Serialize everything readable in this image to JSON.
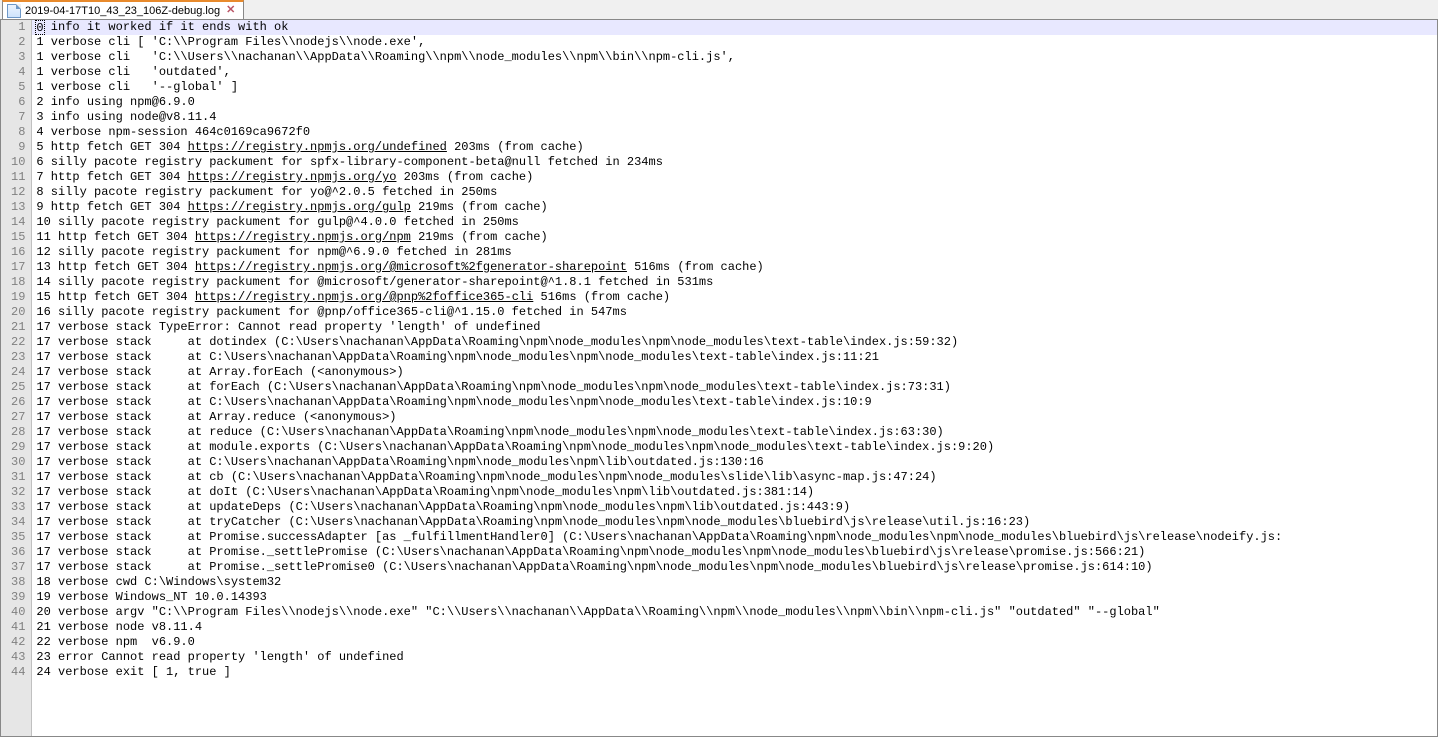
{
  "tab": {
    "title": "2019-04-17T10_43_23_106Z-debug.log",
    "close_glyph": "✕"
  },
  "urls": [
    "https://registry.npmjs.org/undefined",
    "https://registry.npmjs.org/yo",
    "https://registry.npmjs.org/gulp",
    "https://registry.npmjs.org/npm",
    "https://registry.npmjs.org/@microsoft%2fgenerator-sharepoint",
    "https://registry.npmjs.org/@pnp%2foffice365-cli"
  ],
  "lines": [
    {
      "n": 1,
      "type": "first",
      "first_char": "0",
      "rest": " info it worked if it ends with ok"
    },
    {
      "n": 2,
      "text": "1 verbose cli [ 'C:\\\\Program Files\\\\nodejs\\\\node.exe',"
    },
    {
      "n": 3,
      "text": "1 verbose cli   'C:\\\\Users\\\\nachanan\\\\AppData\\\\Roaming\\\\npm\\\\node_modules\\\\npm\\\\bin\\\\npm-cli.js',"
    },
    {
      "n": 4,
      "text": "1 verbose cli   'outdated',"
    },
    {
      "n": 5,
      "text": "1 verbose cli   '--global' ]"
    },
    {
      "n": 6,
      "text": "2 info using npm@6.9.0"
    },
    {
      "n": 7,
      "text": "3 info using node@v8.11.4"
    },
    {
      "n": 8,
      "text": "4 verbose npm-session 464c0169ca9672f0"
    },
    {
      "n": 9,
      "type": "url",
      "pre": "5 http fetch GET 304 ",
      "url_idx": 0,
      "post": " 203ms (from cache)"
    },
    {
      "n": 10,
      "text": "6 silly pacote registry packument for spfx-library-component-beta@null fetched in 234ms"
    },
    {
      "n": 11,
      "type": "url",
      "pre": "7 http fetch GET 304 ",
      "url_idx": 1,
      "post": " 203ms (from cache)"
    },
    {
      "n": 12,
      "text": "8 silly pacote registry packument for yo@^2.0.5 fetched in 250ms"
    },
    {
      "n": 13,
      "type": "url",
      "pre": "9 http fetch GET 304 ",
      "url_idx": 2,
      "post": " 219ms (from cache)"
    },
    {
      "n": 14,
      "text": "10 silly pacote registry packument for gulp@^4.0.0 fetched in 250ms"
    },
    {
      "n": 15,
      "type": "url",
      "pre": "11 http fetch GET 304 ",
      "url_idx": 3,
      "post": " 219ms (from cache)"
    },
    {
      "n": 16,
      "text": "12 silly pacote registry packument for npm@^6.9.0 fetched in 281ms"
    },
    {
      "n": 17,
      "type": "url",
      "pre": "13 http fetch GET 304 ",
      "url_idx": 4,
      "post": " 516ms (from cache)"
    },
    {
      "n": 18,
      "text": "14 silly pacote registry packument for @microsoft/generator-sharepoint@^1.8.1 fetched in 531ms"
    },
    {
      "n": 19,
      "type": "url",
      "pre": "15 http fetch GET 304 ",
      "url_idx": 5,
      "post": " 516ms (from cache)"
    },
    {
      "n": 20,
      "text": "16 silly pacote registry packument for @pnp/office365-cli@^1.15.0 fetched in 547ms"
    },
    {
      "n": 21,
      "text": "17 verbose stack TypeError: Cannot read property 'length' of undefined"
    },
    {
      "n": 22,
      "text": "17 verbose stack     at dotindex (C:\\Users\\nachanan\\AppData\\Roaming\\npm\\node_modules\\npm\\node_modules\\text-table\\index.js:59:32)"
    },
    {
      "n": 23,
      "text": "17 verbose stack     at C:\\Users\\nachanan\\AppData\\Roaming\\npm\\node_modules\\npm\\node_modules\\text-table\\index.js:11:21"
    },
    {
      "n": 24,
      "text": "17 verbose stack     at Array.forEach (<anonymous>)"
    },
    {
      "n": 25,
      "text": "17 verbose stack     at forEach (C:\\Users\\nachanan\\AppData\\Roaming\\npm\\node_modules\\npm\\node_modules\\text-table\\index.js:73:31)"
    },
    {
      "n": 26,
      "text": "17 verbose stack     at C:\\Users\\nachanan\\AppData\\Roaming\\npm\\node_modules\\npm\\node_modules\\text-table\\index.js:10:9"
    },
    {
      "n": 27,
      "text": "17 verbose stack     at Array.reduce (<anonymous>)"
    },
    {
      "n": 28,
      "text": "17 verbose stack     at reduce (C:\\Users\\nachanan\\AppData\\Roaming\\npm\\node_modules\\npm\\node_modules\\text-table\\index.js:63:30)"
    },
    {
      "n": 29,
      "text": "17 verbose stack     at module.exports (C:\\Users\\nachanan\\AppData\\Roaming\\npm\\node_modules\\npm\\node_modules\\text-table\\index.js:9:20)"
    },
    {
      "n": 30,
      "text": "17 verbose stack     at C:\\Users\\nachanan\\AppData\\Roaming\\npm\\node_modules\\npm\\lib\\outdated.js:130:16"
    },
    {
      "n": 31,
      "text": "17 verbose stack     at cb (C:\\Users\\nachanan\\AppData\\Roaming\\npm\\node_modules\\npm\\node_modules\\slide\\lib\\async-map.js:47:24)"
    },
    {
      "n": 32,
      "text": "17 verbose stack     at doIt (C:\\Users\\nachanan\\AppData\\Roaming\\npm\\node_modules\\npm\\lib\\outdated.js:381:14)"
    },
    {
      "n": 33,
      "text": "17 verbose stack     at updateDeps (C:\\Users\\nachanan\\AppData\\Roaming\\npm\\node_modules\\npm\\lib\\outdated.js:443:9)"
    },
    {
      "n": 34,
      "text": "17 verbose stack     at tryCatcher (C:\\Users\\nachanan\\AppData\\Roaming\\npm\\node_modules\\npm\\node_modules\\bluebird\\js\\release\\util.js:16:23)"
    },
    {
      "n": 35,
      "text": "17 verbose stack     at Promise.successAdapter [as _fulfillmentHandler0] (C:\\Users\\nachanan\\AppData\\Roaming\\npm\\node_modules\\npm\\node_modules\\bluebird\\js\\release\\nodeify.js:"
    },
    {
      "n": 36,
      "text": "17 verbose stack     at Promise._settlePromise (C:\\Users\\nachanan\\AppData\\Roaming\\npm\\node_modules\\npm\\node_modules\\bluebird\\js\\release\\promise.js:566:21)"
    },
    {
      "n": 37,
      "text": "17 verbose stack     at Promise._settlePromise0 (C:\\Users\\nachanan\\AppData\\Roaming\\npm\\node_modules\\npm\\node_modules\\bluebird\\js\\release\\promise.js:614:10)"
    },
    {
      "n": 38,
      "text": "18 verbose cwd C:\\Windows\\system32"
    },
    {
      "n": 39,
      "text": "19 verbose Windows_NT 10.0.14393"
    },
    {
      "n": 40,
      "text": "20 verbose argv \"C:\\\\Program Files\\\\nodejs\\\\node.exe\" \"C:\\\\Users\\\\nachanan\\\\AppData\\\\Roaming\\\\npm\\\\node_modules\\\\npm\\\\bin\\\\npm-cli.js\" \"outdated\" \"--global\""
    },
    {
      "n": 41,
      "text": "21 verbose node v8.11.4"
    },
    {
      "n": 42,
      "text": "22 verbose npm  v6.9.0"
    },
    {
      "n": 43,
      "text": "23 error Cannot read property 'length' of undefined"
    },
    {
      "n": 44,
      "text": "24 verbose exit [ 1, true ]"
    }
  ]
}
